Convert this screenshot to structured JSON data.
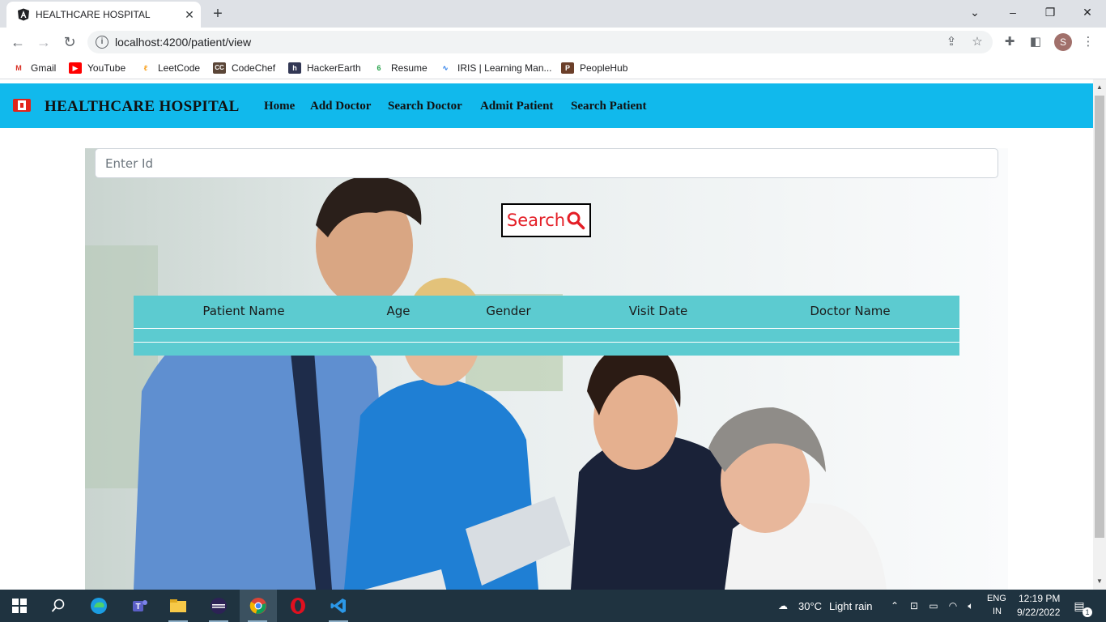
{
  "browser": {
    "tab_title": "HEALTHCARE HOSPITAL",
    "tab_close": "✕",
    "new_tab": "+",
    "url": "localhost:4200/patient/view",
    "profile_initial": "S",
    "bookmarks": [
      {
        "label": "Gmail",
        "icon": "gmail-icon",
        "color": "#d93025"
      },
      {
        "label": "YouTube",
        "icon": "youtube-icon",
        "color": "#ff0000"
      },
      {
        "label": "LeetCode",
        "icon": "leetcode-icon",
        "color": "#f89f1b"
      },
      {
        "label": "CodeChef",
        "icon": "codechef-icon",
        "color": "#5b4638"
      },
      {
        "label": "HackerEarth",
        "icon": "hackerearth-icon",
        "color": "#323754"
      },
      {
        "label": "Resume",
        "icon": "resume-icon",
        "color": "#24a148"
      },
      {
        "label": "IRIS | Learning Man...",
        "icon": "iris-icon",
        "color": "#1a73e8"
      },
      {
        "label": "PeopleHub",
        "icon": "peoplehub-icon",
        "color": "#6b3f2a"
      }
    ]
  },
  "navbar": {
    "brand": "HEALTHCARE HOSPITAL",
    "color": "#11b9ec",
    "links": [
      "Home",
      "Add Doctor",
      "Search Doctor",
      "Admit Patient",
      "Search Patient"
    ]
  },
  "search": {
    "placeholder": "Enter Id",
    "button_label": "Search"
  },
  "table": {
    "headers": [
      "Patient Name",
      "Age",
      "Gender",
      "Visit Date",
      "Doctor Name"
    ],
    "color": "#5ccbd0"
  },
  "taskbar": {
    "weather_temp": "30°C",
    "weather_desc": "Light rain",
    "lang_top": "ENG",
    "lang_bottom": "IN",
    "time": "12:19 PM",
    "date": "9/22/2022",
    "notification_count": "1"
  }
}
